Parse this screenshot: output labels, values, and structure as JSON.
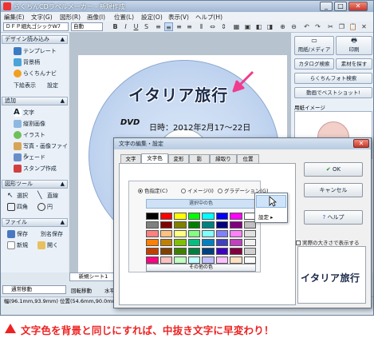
{
  "window": {
    "title": "らくちんCDラベルメーカー - 新規作成"
  },
  "menubar": [
    "編集(E)",
    "文字(G)",
    "図形(R)",
    "画像(I)",
    "位置(L)",
    "設定(O)",
    "表示(V)",
    "ヘルプ(H)"
  ],
  "toolbar": {
    "font": "ＤＦＰ細丸ゴシックW7",
    "font_style": "自動"
  },
  "left_panel": {
    "design_header": "デザイン読み込み",
    "design_items": [
      "テンプレート",
      "背景柄",
      "らくちんナビ"
    ],
    "design_extra": [
      "下絵表示",
      "設定"
    ],
    "add_header": "追加",
    "add_items": [
      "文字",
      "縦割画像",
      "イラスト",
      "写真・画像ファイル",
      "シェード",
      "スタンプ作成"
    ],
    "shape_header": "図形ツール",
    "shape_items": [
      "選択",
      "直線",
      "四角",
      "円"
    ],
    "file_header": "ファイル",
    "file_items": [
      "保存",
      "別名保存",
      "新規",
      "開く"
    ]
  },
  "canvas": {
    "title_text": "イタリア旅行",
    "dvd_logo": "DVD",
    "date_text": "日時：2012年2月17～22日",
    "sheet_tab": "新規シート1"
  },
  "right_panel": {
    "buttons": [
      "用紙/メディア",
      "印刷",
      "カタログ検索",
      "素材を探す",
      "らくちんフォト検索",
      "動画でベストショット!"
    ],
    "image_label": "用紙イメージ"
  },
  "status": {
    "move_mode": "通常移動",
    "rotate": "回転移動",
    "level": "水平",
    "size": "幅(96.1mm,93.9mm)",
    "position": "位置(54.6mm,90.0mm)"
  },
  "dialog": {
    "title": "文字の編集・設定",
    "tabs": [
      "文字",
      "文字色",
      "変形",
      "影",
      "縁取り",
      "位置"
    ],
    "active_tab": "文字色",
    "radio_solid": "色指定(C)",
    "radio_image": "イメージ(I)",
    "radio_gradient": "グラデーション(G)",
    "selected_label": "選択中の色",
    "dropdown_item": "設定",
    "other_colors": "その他の色",
    "ok": "OK",
    "cancel": "キャンセル",
    "help": "ヘルプ",
    "preview_check": "実際の大きさで表示する",
    "preview_text": "イタリア旅行",
    "swatches": [
      "#000000",
      "#ff0000",
      "#ffff00",
      "#00ff00",
      "#00ffff",
      "#0000ff",
      "#ff00ff",
      "#ffffff",
      "#808080",
      "#800000",
      "#808000",
      "#008000",
      "#008080",
      "#000080",
      "#800080",
      "#c0c0c0",
      "#ff8080",
      "#ffc080",
      "#ffff80",
      "#80ff80",
      "#80ffff",
      "#8080ff",
      "#ff80ff",
      "#e0e0e0",
      "#ff8000",
      "#c08000",
      "#80c000",
      "#00c080",
      "#0080c0",
      "#4040c0",
      "#c040c0",
      "#f0f0f0",
      "#c04000",
      "#804000",
      "#408000",
      "#008040",
      "#004080",
      "#4000c0",
      "#800040",
      "#d0d0d0",
      "#ff0080",
      "#ffc0c0",
      "#c0ffc0",
      "#c0ffff",
      "#c0c0ff",
      "#ffc0ff",
      "#ffe0c0",
      "#fafafa"
    ]
  },
  "caption": {
    "text": "文字色を背景と同じにすれば、中抜き文字に早変わり！"
  },
  "colors": {
    "accent": "#e22222",
    "highlight": "#cfe4f8"
  }
}
